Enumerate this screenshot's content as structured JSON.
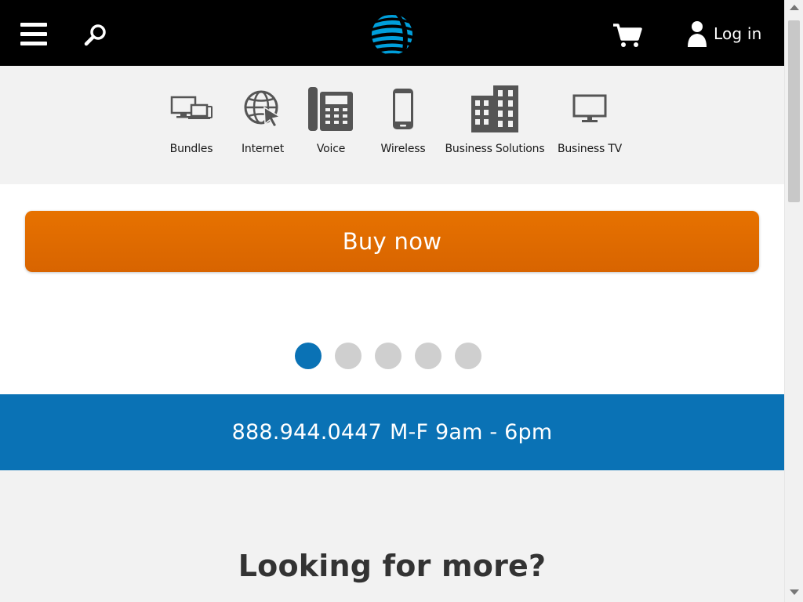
{
  "header": {
    "menu_icon": "hamburger-menu-icon",
    "search_icon": "search-icon",
    "logo_icon": "att-globe-logo",
    "cart_icon": "shopping-cart-icon",
    "user_icon": "user-icon",
    "login_label": "Log in"
  },
  "product_nav": [
    {
      "label": "Bundles",
      "icon": "bundles-icon"
    },
    {
      "label": "Internet",
      "icon": "internet-globe-icon"
    },
    {
      "label": "Voice",
      "icon": "desk-phone-icon"
    },
    {
      "label": "Wireless",
      "icon": "mobile-phone-icon"
    },
    {
      "label": "Business Solutions",
      "icon": "building-icon"
    },
    {
      "label": "Business TV",
      "icon": "monitor-icon"
    }
  ],
  "buy": {
    "label": "Buy now"
  },
  "carousel": {
    "count": 5,
    "active": 1
  },
  "contact": {
    "phone": "888.944.0447",
    "hours": "M-F 9am - 6pm"
  },
  "more": {
    "title": "Looking for more?"
  },
  "colors": {
    "header_bg": "#000000",
    "accent_orange": "#e77200",
    "brand_blue": "#0a72b5",
    "icon_gray": "#555555"
  }
}
